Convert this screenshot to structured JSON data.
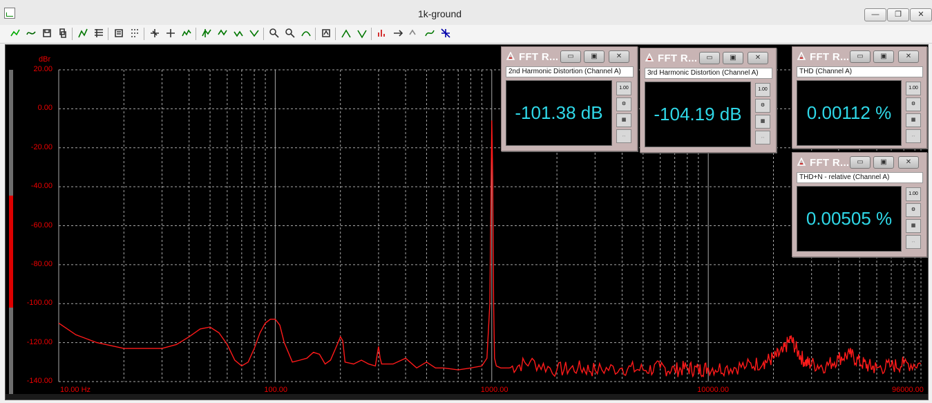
{
  "window": {
    "title": "1k-ground",
    "buttons": {
      "minimize": "—",
      "restore": "❐",
      "close": "✕"
    }
  },
  "toolbar": {
    "icons": [
      "sweep-icon",
      "generator-icon",
      "save-icon",
      "copy-icon",
      "graph-icon",
      "table-icon",
      "settings-icon",
      "grid-icon",
      "zoom-in-icon",
      "zoom-out-icon",
      "autoscale-icon",
      "cursor-icon",
      "cursor2-icon",
      "cursor3-icon",
      "cursor4-icon",
      "zoom-x-icon",
      "zoom-y-icon",
      "fit-icon",
      "analyzer-icon",
      "marker-icon",
      "marker2-icon",
      "bargraph-icon",
      "arrow-icon",
      "ref-icon",
      "compare-icon",
      "move-icon"
    ]
  },
  "graph": {
    "y_unit": "dBr",
    "y_ticks": [
      "20.00",
      "0.00",
      "-20.00",
      "-40.00",
      "-60.00",
      "-80.00",
      "-100.00",
      "-120.00",
      "-140.00"
    ],
    "x_ticks": [
      "10.00 Hz",
      "100.00",
      "1000.00",
      "10000.00",
      "96000.00"
    ],
    "accent": "#ff1a1a",
    "grid_color": "#aaaaaa",
    "meter_level": 0.34
  },
  "chart_data": {
    "type": "line",
    "title": "",
    "xlabel": "",
    "ylabel": "dBr",
    "xscale": "log",
    "xlim": [
      10,
      96000
    ],
    "ylim": [
      -140,
      20
    ],
    "series": [
      {
        "x": [
          10,
          12,
          15,
          20,
          25,
          30,
          35,
          40,
          45,
          50,
          55,
          60,
          65,
          70,
          75,
          80,
          85,
          90,
          95,
          100,
          105,
          110,
          120,
          130,
          140,
          150,
          160,
          170,
          180,
          190,
          195,
          200,
          205,
          210,
          230,
          250,
          270,
          290,
          295,
          300,
          305,
          310,
          350,
          400,
          450,
          500,
          550,
          600,
          700,
          800,
          900,
          950,
          980,
          1000,
          1010,
          1020,
          1030,
          1050,
          1100,
          1200,
          1500,
          2000,
          2500,
          3000,
          4000,
          5000,
          6000,
          7000,
          8000,
          9000,
          10000,
          12000,
          15000,
          18000,
          20000,
          22000,
          24000,
          26000,
          28000,
          30000,
          35000,
          40000,
          45000,
          50000,
          55000,
          60000,
          70000,
          80000,
          96000
        ],
        "y": [
          -110,
          -116,
          -120,
          -123,
          -123,
          -123,
          -121,
          -117,
          -113,
          -112,
          -115,
          -121,
          -129,
          -132,
          -130,
          -123,
          -115,
          -110,
          -108,
          -108,
          -111,
          -120,
          -130,
          -129,
          -128,
          -125,
          -126,
          -131,
          -129,
          -123,
          -120,
          -117,
          -119,
          -130,
          -131,
          -129,
          -131,
          -132,
          -127,
          -122,
          -128,
          -131,
          -131,
          -128,
          -133,
          -130,
          -133,
          -133,
          -134,
          -133,
          -132,
          -128,
          -100,
          -6,
          -35,
          -100,
          -128,
          -132,
          -133,
          -133,
          -130,
          -134,
          -133,
          -134,
          -133,
          -134,
          -133,
          -134,
          -133,
          -134,
          -133,
          -133,
          -132,
          -130,
          -128,
          -125,
          -118,
          -125,
          -130,
          -131,
          -132,
          -128,
          -126,
          -130,
          -132,
          -133,
          -132,
          -131,
          -131
        ]
      }
    ]
  },
  "fft_panels": [
    {
      "title": "FFT R...",
      "subtitle": "2nd Harmonic Distortion (Channel A)",
      "value": "-101.38 dB",
      "tool_label": "1.00"
    },
    {
      "title": "FFT R...",
      "subtitle": "3rd Harmonic Distortion (Channel A)",
      "value": "-104.19 dB",
      "tool_label": "1.00"
    },
    {
      "title": "FFT R...",
      "subtitle": "THD (Channel A)",
      "value": "0.00112 %",
      "tool_label": "1.00"
    },
    {
      "title": "FFT R...",
      "subtitle": "THD+N - relative (Channel A)",
      "value": "0.00505 %",
      "tool_label": "1.00"
    }
  ]
}
